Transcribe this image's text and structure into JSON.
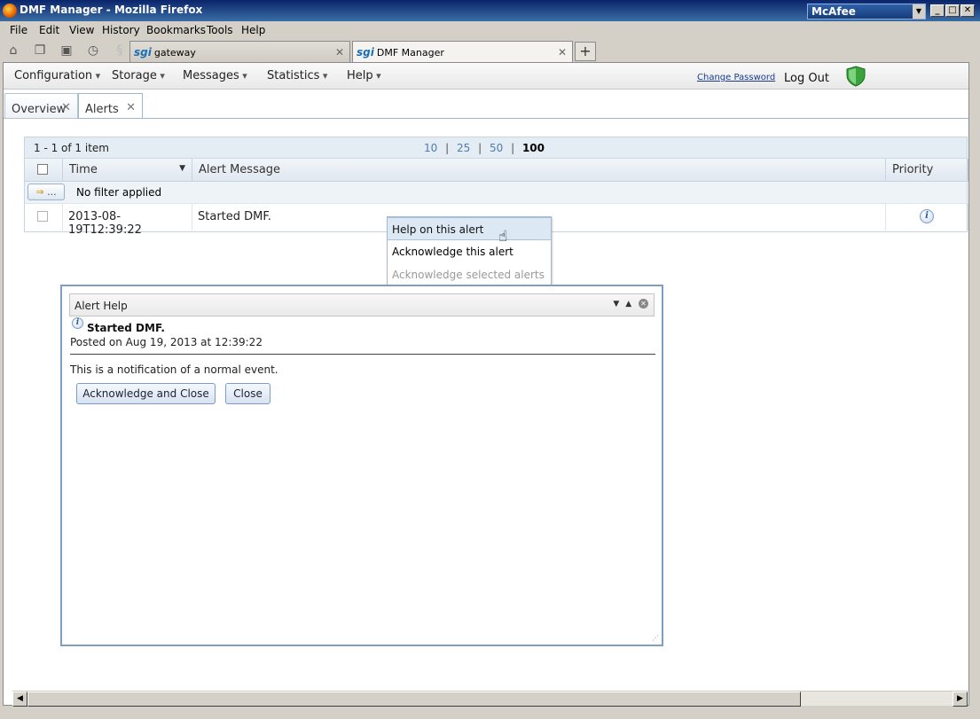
{
  "window": {
    "title": "DMF Manager - Mozilla Firefox",
    "mcafee_label": "McAfee",
    "controls": [
      "_",
      "□",
      "✕"
    ]
  },
  "browser_menu": [
    "File",
    "Edit",
    "View",
    "History",
    "Bookmarks",
    "Tools",
    "Help"
  ],
  "browser_tabs": [
    {
      "logo": "sgi",
      "label": "gateway",
      "active": false
    },
    {
      "logo": "sgi",
      "label": "DMF Manager",
      "active": true
    }
  ],
  "app_menu": {
    "items": [
      "Configuration",
      "Storage",
      "Messages",
      "Statistics",
      "Help"
    ],
    "change_password": "Change Password",
    "logout": "Log Out"
  },
  "app_tabs": [
    {
      "label": "Overview",
      "active": false
    },
    {
      "label": "Alerts",
      "active": true
    }
  ],
  "grid": {
    "count_text": "1 - 1 of 1 item",
    "page_sizes": [
      "10",
      "25",
      "50",
      "100"
    ],
    "page_size_selected": "100",
    "columns": [
      "Time",
      "Alert Message",
      "Priority"
    ],
    "filter_button": "...",
    "filter_text": "No filter applied",
    "rows": [
      {
        "time": "2013-08-19T12:39:22",
        "message": "Started DMF.",
        "priority_icon": "info-icon"
      }
    ]
  },
  "context_menu": {
    "items": [
      "Help on this alert",
      "Acknowledge this alert",
      "Acknowledge selected alerts"
    ],
    "hovered": "Help on this alert",
    "disabled": [
      "Acknowledge selected alerts"
    ]
  },
  "dialog": {
    "title": "Alert Help",
    "message": "Started DMF.",
    "posted": "Posted on Aug 19, 2013 at 12:39:22",
    "description": "This is a notification of a normal event.",
    "ack_close_button": "Acknowledge and Close",
    "close_button": "Close"
  }
}
